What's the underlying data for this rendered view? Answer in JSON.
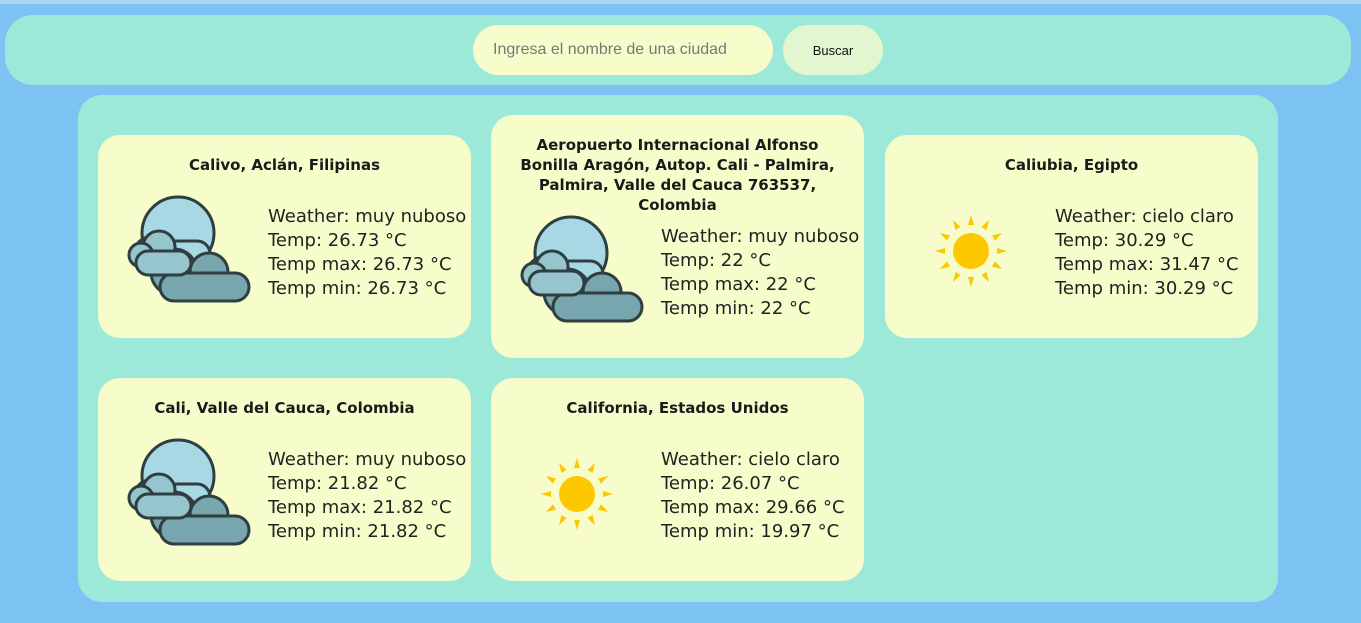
{
  "search": {
    "placeholder": "Ingresa el nombre de una ciudad",
    "button_label": "Buscar"
  },
  "cards": [
    {
      "title": "Calivo, Aclán, Filipinas",
      "icon": "cloudy-icon",
      "weather": "Weather: muy nuboso",
      "temp": "Temp: 26.73 °C",
      "temp_max": "Temp max: 26.73 °C",
      "temp_min": "Temp min: 26.73 °C"
    },
    {
      "title": "Aeropuerto Internacional Alfonso Bonilla Aragón, Autop. Cali - Palmira, Palmira, Valle del Cauca 763537, Colombia",
      "icon": "cloudy-icon",
      "weather": "Weather: muy nuboso",
      "temp": "Temp: 22 °C",
      "temp_max": "Temp max: 22 °C",
      "temp_min": "Temp min: 22 °C"
    },
    {
      "title": "Caliubia, Egipto",
      "icon": "sun-icon",
      "weather": "Weather: cielo claro",
      "temp": "Temp: 30.29 °C",
      "temp_max": "Temp max: 31.47 °C",
      "temp_min": "Temp min: 30.29 °C"
    },
    {
      "title": "Cali, Valle del Cauca, Colombia",
      "icon": "cloudy-icon",
      "weather": "Weather: muy nuboso",
      "temp": "Temp: 21.82 °C",
      "temp_max": "Temp max: 21.82 °C",
      "temp_min": "Temp min: 21.82 °C"
    },
    {
      "title": "California, Estados Unidos",
      "icon": "sun-icon",
      "weather": "Weather: cielo claro",
      "temp": "Temp: 26.07 °C",
      "temp_max": "Temp max: 29.66 °C",
      "temp_min": "Temp min: 19.97 °C"
    }
  ],
  "colors": {
    "background": "#7cc3f3",
    "panel": "#9ce8d9",
    "card": "#f7fccb",
    "sun": "#fdc800"
  }
}
